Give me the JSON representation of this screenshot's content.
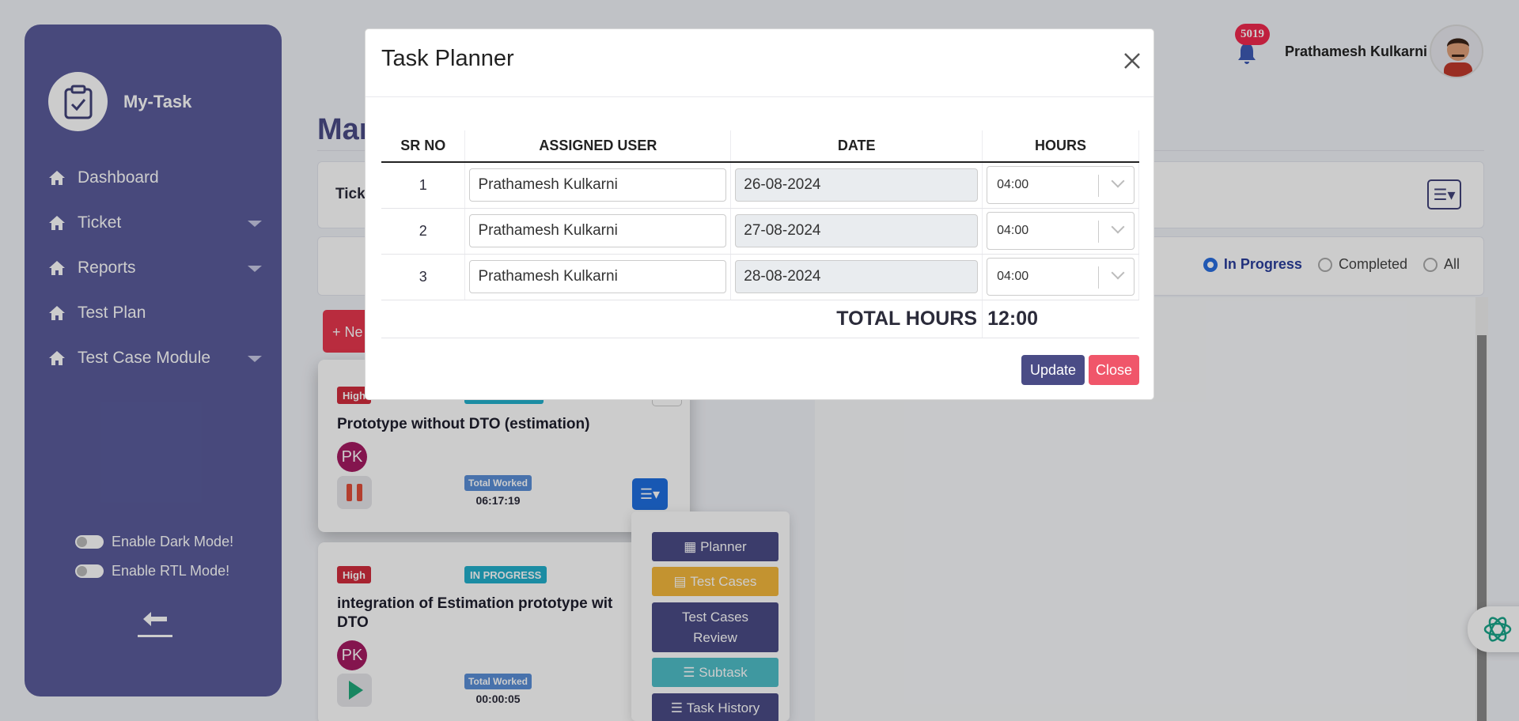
{
  "app": {
    "name": "My-Task"
  },
  "sidebar": {
    "items": [
      {
        "label": "Dashboard",
        "has_caret": false
      },
      {
        "label": "Ticket",
        "has_caret": true
      },
      {
        "label": "Reports",
        "has_caret": true
      },
      {
        "label": "Test Plan",
        "has_caret": false
      },
      {
        "label": "Test Case Module",
        "has_caret": true
      }
    ],
    "toggles": {
      "dark_mode": "Enable Dark Mode!",
      "rtl_mode": "Enable RTL Mode!"
    }
  },
  "header": {
    "notification_count": "5019",
    "user_name": "Prathamesh Kulkarni"
  },
  "page": {
    "title": "Man",
    "filter_label": "Tick",
    "new_button": "+ Ne",
    "status_filters": [
      {
        "label": "In Progress",
        "selected": true
      },
      {
        "label": "Completed",
        "selected": false
      },
      {
        "label": "All",
        "selected": false
      }
    ]
  },
  "tasks": [
    {
      "priority": "High",
      "status": "",
      "title": "Prototype without DTO (estimation)",
      "assignee_initials": "PK",
      "worked_label": "Total Worked",
      "worked_time": "06:17:19",
      "state": "pause"
    },
    {
      "priority": "High",
      "status": "IN PROGRESS",
      "title": "integration of Estimation prototype wit DTO",
      "assignee_initials": "PK",
      "worked_label": "Total Worked",
      "worked_time": "00:00:05",
      "state": "play"
    }
  ],
  "task_menu": {
    "planner": "Planner",
    "test_cases": "Test Cases",
    "test_cases_review": "Test Cases Review",
    "subtask": "Subtask",
    "task_history": "Task History"
  },
  "modal": {
    "title": "Task Planner",
    "columns": [
      "SR NO",
      "ASSIGNED USER",
      "DATE",
      "HOURS"
    ],
    "rows": [
      {
        "sr": "1",
        "user": "Prathamesh Kulkarni",
        "date": "26-08-2024",
        "hours": "04:00"
      },
      {
        "sr": "2",
        "user": "Prathamesh Kulkarni",
        "date": "27-08-2024",
        "hours": "04:00"
      },
      {
        "sr": "3",
        "user": "Prathamesh Kulkarni",
        "date": "28-08-2024",
        "hours": "04:00"
      }
    ],
    "total_label": "TOTAL HOURS",
    "total_value": "12:00",
    "update_button": "Update",
    "close_button": "Close"
  },
  "colors": {
    "sidebar": "#5a5c9c",
    "primary": "#4a4c86",
    "danger": "#f0566a",
    "high_badge": "#d12c3d",
    "progress_badge": "#22b0cc"
  }
}
